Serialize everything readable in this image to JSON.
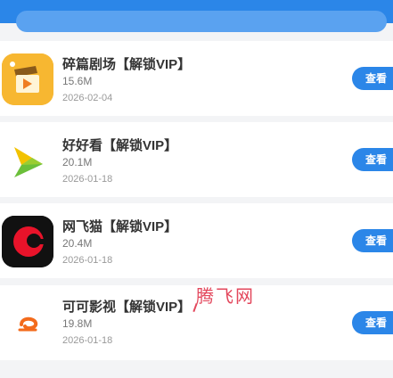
{
  "apps": [
    {
      "name": "碎篇剧场【解锁VIP】",
      "size": "15.6M",
      "date": "2026-02-04",
      "button": "查看",
      "icon": "film-clapper-icon"
    },
    {
      "name": "好好看【解锁VIP】",
      "size": "20.1M",
      "date": "2026-01-18",
      "button": "查看",
      "icon": "play-arrow-icon"
    },
    {
      "name": "网飞猫【解锁VIP】",
      "size": "20.4M",
      "date": "2026-01-18",
      "button": "查看",
      "icon": "c-logo-icon"
    },
    {
      "name": "可可影视【解锁VIP】",
      "size": "19.8M",
      "date": "2026-01-18",
      "button": "查看",
      "icon": "orange-swirl-icon"
    }
  ],
  "watermark": "腾飞网",
  "colors": {
    "accent": "#2b86e8",
    "watermark": "#e3475c"
  }
}
